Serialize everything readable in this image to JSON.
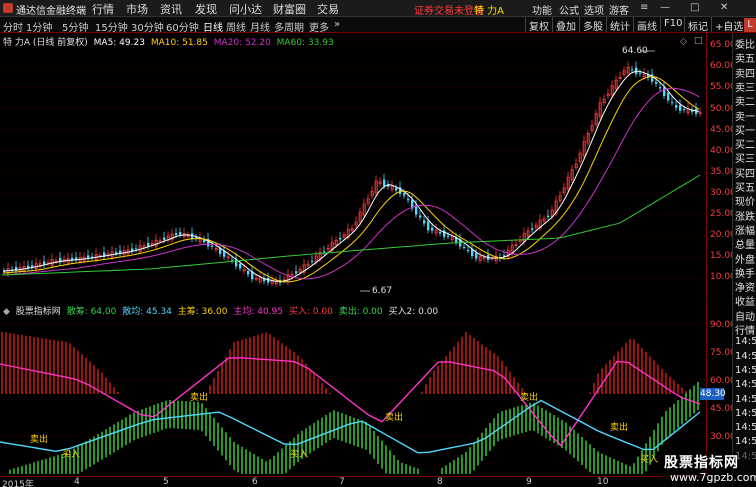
{
  "titlebar": {
    "app_name": "通达信金融终端",
    "menus": [
      "行情",
      "市场",
      "资讯",
      "发现",
      "问小达",
      "财富圈",
      "交易"
    ],
    "status": "证券交易未登录",
    "stock_name": "特 力A",
    "right_menus": [
      "功能",
      "公式",
      "选项",
      "游客"
    ]
  },
  "toolbar": {
    "periods": [
      "分时",
      "1分钟",
      "5分钟",
      "15分钟",
      "30分钟",
      "60分钟",
      "日线",
      "周线",
      "月线",
      "多周期",
      "更多"
    ],
    "active_period": "日线",
    "right_buttons": [
      "复权",
      "叠加",
      "多股",
      "统计",
      "画线",
      "F10",
      "标记",
      "+自选"
    ]
  },
  "main_chart": {
    "legend_title": "特 力A (日线 前复权)",
    "ma5_label": "MA5: 49.23",
    "ma10_label": "MA10: 51.85",
    "ma20_label": "MA20: 52.20",
    "ma60_label": "MA60: 33.93",
    "high_annotation": "64.60",
    "low_annotation": "6.67",
    "colors": {
      "ma5": "#ffffff",
      "ma10": "#ffd400",
      "ma20": "#cc33cc",
      "ma60": "#33cc33",
      "up": "#ff3b3b",
      "down": "#4fd9ff"
    },
    "y_ticks": [
      "65.00",
      "60.00",
      "55.00",
      "50.00",
      "45.00",
      "40.00",
      "35.00",
      "30.00",
      "25.00",
      "20.00",
      "15.00",
      "10.00"
    ]
  },
  "indicator_chart": {
    "title": "股票指标网",
    "retail_label": "散筹: 64.00",
    "retail_avg_label": "散均: 45.34",
    "main_label": "主筹: 36.00",
    "main_avg_label": "主均: 40.95",
    "buy_label": "买入: 0.00",
    "sell_label": "卖出: 0.00",
    "buy2_label": "买入2: 0.00",
    "y_ticks": [
      "90.00",
      "75.00",
      "60.00",
      "45.00",
      "30.00"
    ],
    "price_tag": "48.30",
    "markers": {
      "sell": "卖出",
      "buy": "买入"
    }
  },
  "side_panel": {
    "badge": "L",
    "items": [
      "委比",
      "卖五",
      "卖四",
      "卖三",
      "卖二",
      "卖一",
      "买一",
      "买二",
      "买三",
      "买四",
      "买五",
      "现价",
      "涨跌",
      "涨幅",
      "总量",
      "外盘",
      "换手",
      "净资",
      "收益",
      "自动",
      "行情",
      "14:5",
      "14:5",
      "14:5",
      "14:5",
      "14:5",
      "14:5",
      "14:5",
      "14:5",
      "14:5"
    ]
  },
  "date_axis": {
    "labels": [
      "2015年",
      "4",
      "5",
      "6",
      "7",
      "8",
      "9",
      "10"
    ]
  },
  "watermark": {
    "line1": "股票指标网",
    "line2": "www.7gpzb.com"
  }
}
